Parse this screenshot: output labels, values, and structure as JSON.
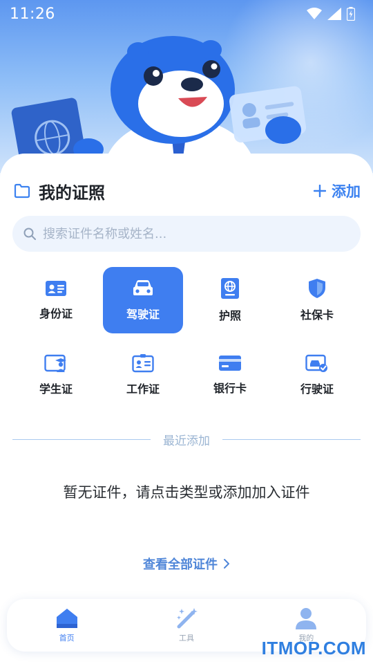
{
  "status_bar": {
    "time": "11:26"
  },
  "header": {
    "title": "我的证照",
    "add_label": "添加"
  },
  "search": {
    "placeholder": "搜索证件名称或姓名..."
  },
  "categories": [
    {
      "label": "身份证",
      "icon": "id-card-icon",
      "selected": false
    },
    {
      "label": "驾驶证",
      "icon": "car-icon",
      "selected": true
    },
    {
      "label": "护照",
      "icon": "passport-icon",
      "selected": false
    },
    {
      "label": "社保卡",
      "icon": "shield-icon",
      "selected": false
    },
    {
      "label": "学生证",
      "icon": "student-card-icon",
      "selected": false
    },
    {
      "label": "工作证",
      "icon": "work-badge-icon",
      "selected": false
    },
    {
      "label": "银行卡",
      "icon": "bank-card-icon",
      "selected": false
    },
    {
      "label": "行驶证",
      "icon": "vehicle-license-icon",
      "selected": false
    }
  ],
  "recent": {
    "divider_label": "最近添加",
    "empty_text": "暂无证件，请点击类型或添加加入证件",
    "view_all_label": "查看全部证件"
  },
  "tabbar": {
    "items": [
      {
        "label": "首页",
        "icon": "home-icon",
        "active": true
      },
      {
        "label": "工具",
        "icon": "magic-wand-icon",
        "active": false
      },
      {
        "label": "我的",
        "icon": "user-icon",
        "active": false
      }
    ]
  },
  "watermark": "ITMOP.COM",
  "colors": {
    "accent": "#3f7ef0",
    "hero_top": "#5d97f0",
    "text": "#1f2329"
  }
}
